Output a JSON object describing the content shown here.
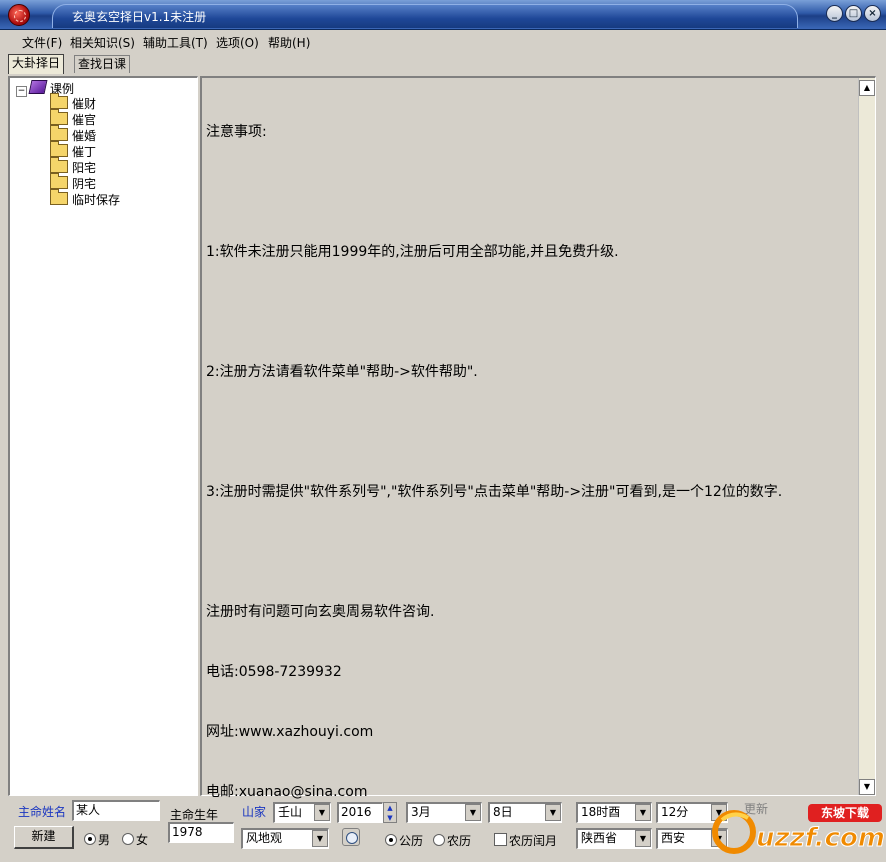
{
  "window": {
    "title": "玄奥玄空择日v1.1未注册"
  },
  "menu": [
    "文件(F)",
    "相关知识(S)",
    "辅助工具(T)",
    "选项(O)",
    "帮助(H)"
  ],
  "tabs": [
    "大卦择日",
    "查找日课"
  ],
  "tree": {
    "root": "课例",
    "children": [
      "催财",
      "催官",
      "催婚",
      "催丁",
      "阳宅",
      "阴宅",
      "临时保存"
    ]
  },
  "notice": {
    "lines": [
      "注意事项:",
      "",
      "1:软件未注册只能用1999年的,注册后可用全部功能,并且免费升级.",
      "",
      "2:注册方法请看软件菜单\"帮助->软件帮助\".",
      "",
      "3:注册时需提供\"软件系列号\",\"软件系列号\"点击菜单\"帮助->注册\"可看到,是一个12位的数字.",
      "",
      "注册时有问题可向玄奥周易软件咨询.",
      "电话:0598-7239932",
      "网址:www.xazhouyi.com",
      "电邮:xuanao@sina.com"
    ]
  },
  "form": {
    "name_label": "主命姓名",
    "name_value": "某人",
    "birth_label": "主命生年",
    "birth_value": "1978",
    "mountain_label": "山家",
    "mountain_value": "壬山",
    "year_value": "2016",
    "month_value": "3月",
    "day_value": "8日",
    "hour_value": "18时酉",
    "minute_value": "12分",
    "style_value": "风地观",
    "province_value": "陕西省",
    "city_value": "西安",
    "new_button": "新建",
    "gender_male": "男",
    "gender_female": "女",
    "cal_solar": "公历",
    "cal_lunar": "农历",
    "leap_label": "农历闰月",
    "refresh_label": "更新"
  },
  "watermark": {
    "text": "uzzf.com",
    "tagline": "东坡下载"
  },
  "colors": {
    "title_blue": "#1c3f86",
    "label_blue": "#1a36c0",
    "watermark_orange": "#f08a00"
  }
}
